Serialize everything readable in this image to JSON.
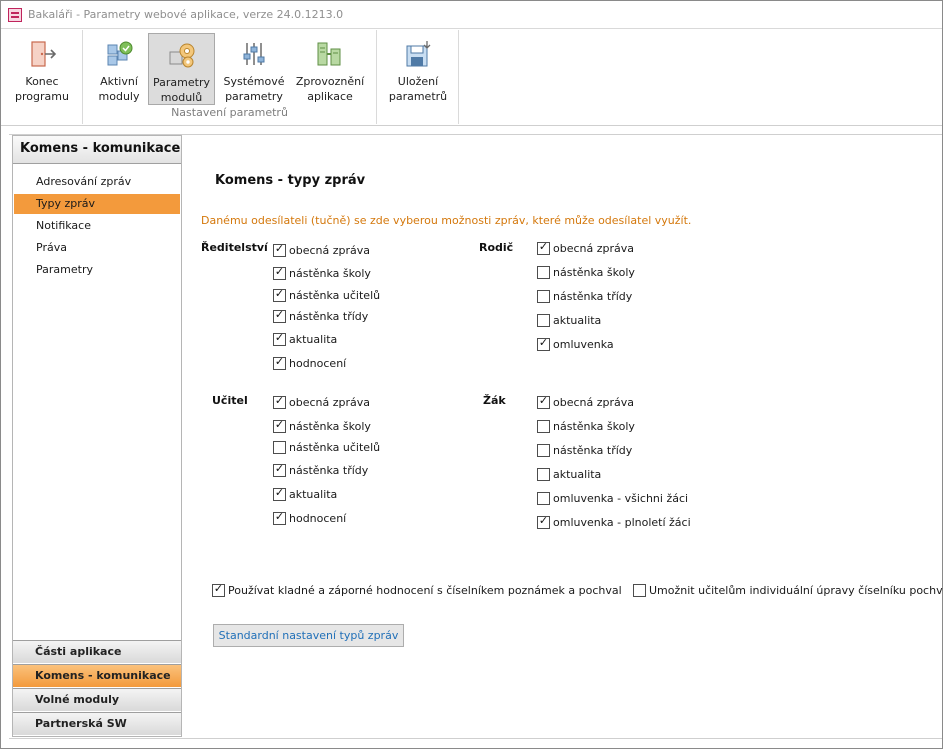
{
  "window": {
    "title": "Bakaláři - Parametry webové aplikace, verze 24.0.1213.0"
  },
  "ribbon": {
    "buttons": [
      {
        "label_line1": "Konec",
        "label_line2": "programu",
        "icon": "exit-door-icon"
      },
      {
        "label_line1": "Aktivní",
        "label_line2": "moduly",
        "icon": "active-modules-icon"
      },
      {
        "label_line1": "Parametry",
        "label_line2": "modulů",
        "icon": "module-parameters-icon"
      },
      {
        "label_line1": "Systémové",
        "label_line2": "parametry",
        "icon": "system-parameters-icon"
      },
      {
        "label_line1": "Zprovoznění",
        "label_line2": "aplikace",
        "icon": "deploy-app-icon"
      },
      {
        "label_line1": "Uložení",
        "label_line2": "parametrů",
        "icon": "save-parameters-icon"
      }
    ],
    "group_label": "Nastavení parametrů"
  },
  "sidebar": {
    "header": "Komens - komunikace",
    "items": [
      {
        "label": "Adresování zpráv",
        "selected": false
      },
      {
        "label": "Typy zpráv",
        "selected": true
      },
      {
        "label": "Notifikace",
        "selected": false
      },
      {
        "label": "Práva",
        "selected": false
      },
      {
        "label": "Parametry",
        "selected": false
      }
    ],
    "bottom_items": [
      {
        "label": "Části aplikace",
        "selected": false
      },
      {
        "label": "Komens - komunikace",
        "selected": true
      },
      {
        "label": "Volné moduly",
        "selected": false
      },
      {
        "label": "Partnerská SW",
        "selected": false
      }
    ]
  },
  "main": {
    "title": "Komens - typy zpráv",
    "info": "Danému odesílateli (tučně) se zde vyberou možnosti zpráv, které může odesílatel využít.",
    "groups": [
      {
        "role": "Ředitelství",
        "options": [
          {
            "label": "obecná zpráva",
            "checked": true
          },
          {
            "label": "nástěnka školy",
            "checked": true
          },
          {
            "label": "nástěnka učitelů",
            "checked": true
          },
          {
            "label": "nástěnka třídy",
            "checked": true
          },
          {
            "label": "aktualita",
            "checked": true
          },
          {
            "label": "hodnocení",
            "checked": true
          }
        ]
      },
      {
        "role": "Rodič",
        "options": [
          {
            "label": "obecná zpráva",
            "checked": true
          },
          {
            "label": "nástěnka školy",
            "checked": false
          },
          {
            "label": "nástěnka třídy",
            "checked": false
          },
          {
            "label": "aktualita",
            "checked": false
          },
          {
            "label": "omluvenka",
            "checked": true
          }
        ]
      },
      {
        "role": "Učitel",
        "options": [
          {
            "label": "obecná zpráva",
            "checked": true
          },
          {
            "label": "nástěnka školy",
            "checked": true
          },
          {
            "label": "nástěnka učitelů",
            "checked": false
          },
          {
            "label": "nástěnka třídy",
            "checked": true
          },
          {
            "label": "aktualita",
            "checked": true
          },
          {
            "label": "hodnocení",
            "checked": true
          }
        ]
      },
      {
        "role": "Žák",
        "options": [
          {
            "label": "obecná zpráva",
            "checked": true
          },
          {
            "label": "nástěnka školy",
            "checked": false
          },
          {
            "label": "nástěnka třídy",
            "checked": false
          },
          {
            "label": "aktualita",
            "checked": false
          },
          {
            "label": "omluvenka - všichni žáci",
            "checked": false
          },
          {
            "label": "omluvenka - plnoletí žáci",
            "checked": true
          }
        ]
      }
    ],
    "use_grading_codebook": {
      "label": "Používat kladné a záporné hodnocení s číselníkem poznámek a pochval",
      "checked": true
    },
    "allow_teacher_codebook": {
      "label": "Umožnit učitelům individuální úpravy číselníku pochval",
      "checked": false
    },
    "default_button": "Standardní nastavení typů zpráv"
  },
  "colors": {
    "accent_orange": "#f39a3c",
    "info_text": "#d4780c",
    "button_text": "#2170b8"
  }
}
